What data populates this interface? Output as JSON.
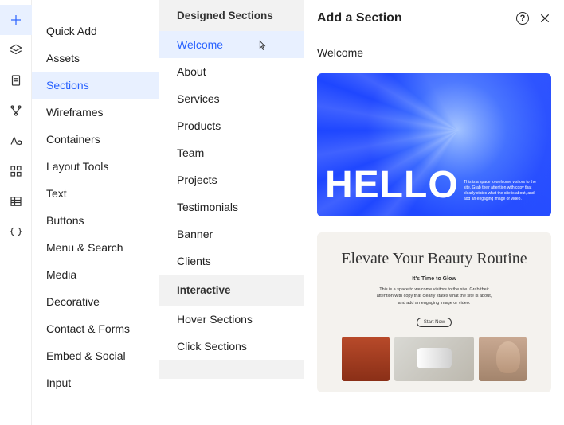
{
  "rail": [
    "plus-icon",
    "layers-icon",
    "page-icon",
    "structure-icon",
    "typography-icon",
    "grid-icon",
    "table-icon",
    "code-icon"
  ],
  "rail_active_index": 0,
  "col1": {
    "items": [
      "Quick Add",
      "Assets",
      "Sections",
      "Wireframes",
      "Containers",
      "Layout Tools",
      "Text",
      "Buttons",
      "Menu & Search",
      "Media",
      "Decorative",
      "Contact & Forms",
      "Embed & Social",
      "Input"
    ],
    "active_index": 2
  },
  "col2": {
    "groups": [
      {
        "header": "Designed Sections",
        "items": [
          "Welcome",
          "About",
          "Services",
          "Products",
          "Team",
          "Projects",
          "Testimonials",
          "Banner",
          "Clients"
        ],
        "active_index": 0
      },
      {
        "header": "Interactive",
        "items": [
          "Hover Sections",
          "Click Sections"
        ],
        "active_index": -1
      }
    ]
  },
  "panel": {
    "title": "Add a Section",
    "help": "?",
    "subtitle": "Welcome",
    "hello": {
      "big": "HELLO",
      "small": "This is a space to welcome visitors to the site. Grab their attention with copy that clearly states what the site is about, and add an engaging image or video."
    },
    "beauty": {
      "title": "Elevate Your Beauty Routine",
      "sub": "It's Time to Glow",
      "body": "This is a space to welcome visitors to the site. Grab their attention with copy that clearly states what the site is about, and add an engaging image or video.",
      "cta": "Start Now"
    }
  }
}
